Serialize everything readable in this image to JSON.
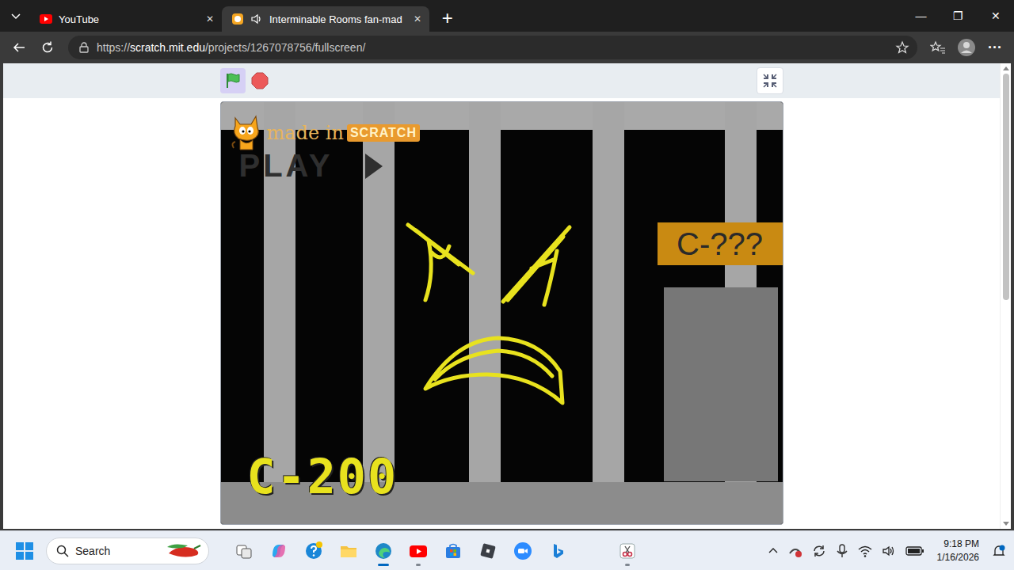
{
  "window": {
    "controls": [
      "—",
      "❐",
      "✕"
    ]
  },
  "tabs": [
    {
      "label": "YouTube",
      "selected": false,
      "audio": false,
      "close": "✕"
    },
    {
      "label": "Interminable Rooms fan-mad",
      "selected": true,
      "audio": true,
      "close": "✕"
    }
  ],
  "new_tab": "+",
  "address": {
    "scheme": "https://",
    "host": "scratch.mit.edu",
    "path": "/projects/1267078756/fullscreen/"
  },
  "menu": "···",
  "scratch": {
    "green_flag_active": true,
    "stage": {
      "watermark_made": "made in",
      "watermark_brand": "SCRATCH",
      "play": "PLAY",
      "sign": "C-???",
      "room": "C-200"
    }
  },
  "taskbar": {
    "search_placeholder": "Search",
    "apps": [
      {
        "kind": "taskview",
        "running": false,
        "active": false
      },
      {
        "kind": "copilot",
        "running": false,
        "active": false
      },
      {
        "kind": "help",
        "running": false,
        "active": false
      },
      {
        "kind": "explorer",
        "running": false,
        "active": false
      },
      {
        "kind": "edge",
        "running": true,
        "active": true
      },
      {
        "kind": "youtube",
        "running": true,
        "active": false
      },
      {
        "kind": "store",
        "running": false,
        "active": false
      },
      {
        "kind": "roblox",
        "running": false,
        "active": false
      },
      {
        "kind": "zoom",
        "running": false,
        "active": false
      },
      {
        "kind": "bing",
        "running": false,
        "active": false
      },
      {
        "kind": "snipping",
        "running": true,
        "active": false
      }
    ],
    "time": "9:18 PM",
    "date": "1/16/2026"
  }
}
